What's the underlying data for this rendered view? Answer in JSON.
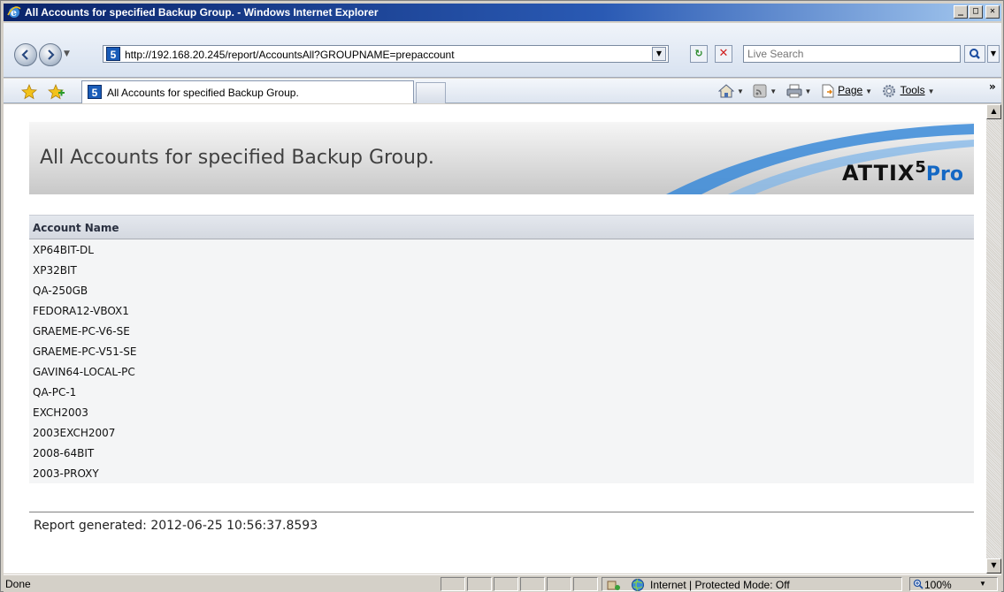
{
  "window": {
    "title": "All Accounts for specified Backup Group. - Windows Internet Explorer"
  },
  "address_bar": {
    "url": "http://192.168.20.245/report/AccountsAll?GROUPNAME=prepaccount",
    "site_icon_label": "5"
  },
  "search": {
    "placeholder": "Live Search"
  },
  "tab": {
    "label": "All Accounts for specified Backup Group."
  },
  "command_bar": {
    "page_label": "Page",
    "tools_label": "Tools"
  },
  "report": {
    "banner_title": "All Accounts for specified Backup Group.",
    "logo_main": "ATTIX",
    "logo_sup": "5",
    "logo_pro": "Pro",
    "column_header": "Account Name",
    "accounts": [
      "XP64BIT-DL",
      "XP32BIT",
      "QA-250GB",
      "FEDORA12-VBOX1",
      "GRAEME-PC-V6-SE",
      "GRAEME-PC-V51-SE",
      "GAVIN64-LOCAL-PC",
      "QA-PC-1",
      "EXCH2003",
      "2003EXCH2007",
      "2008-64BIT",
      "2003-PROXY"
    ],
    "generated": "Report generated: 2012-06-25 10:56:37.8593"
  },
  "status_bar": {
    "status": "Done",
    "zone": "Internet | Protected Mode: Off",
    "zoom": "100%"
  },
  "colors": {
    "title_bar": "#0a246a",
    "logo_accent": "#1468c4",
    "banner_swoosh": "#3a8ad8"
  }
}
